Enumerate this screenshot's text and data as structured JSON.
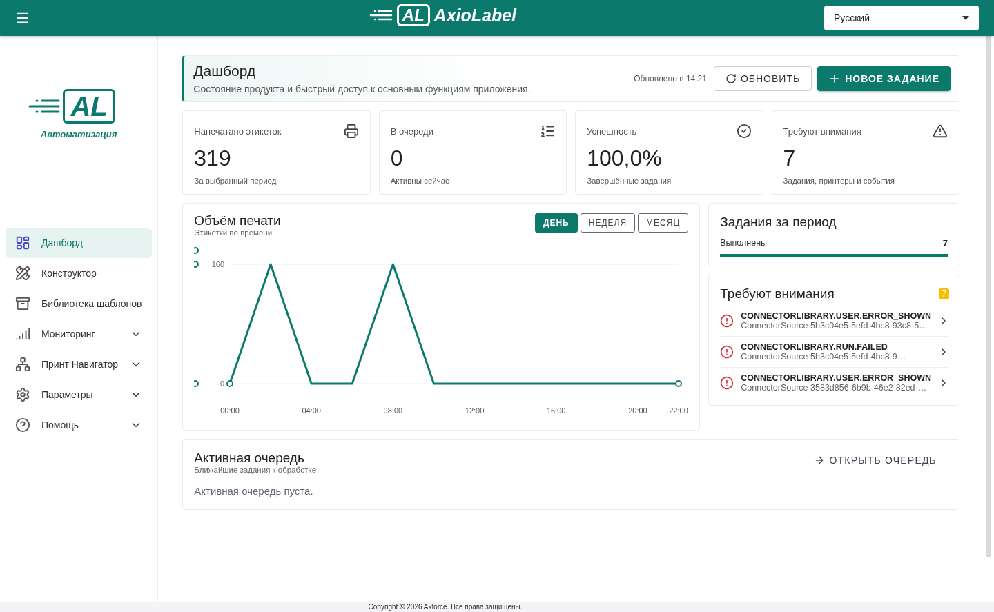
{
  "header": {
    "logo_mark": "AL",
    "brand": "AxioLabel",
    "language": "Русский"
  },
  "sidebar": {
    "logo_mark": "AL",
    "logo_caption": "Автоматизация",
    "items": [
      {
        "label": "Дашборд",
        "selected": true,
        "expandable": false
      },
      {
        "label": "Конструктор",
        "selected": false,
        "expandable": false
      },
      {
        "label": "Библиотека шаблонов",
        "selected": false,
        "expandable": false
      },
      {
        "label": "Мониторинг",
        "selected": false,
        "expandable": true
      },
      {
        "label": "Принт Навигатор",
        "selected": false,
        "expandable": true
      },
      {
        "label": "Параметры",
        "selected": false,
        "expandable": true
      },
      {
        "label": "Помощь",
        "selected": false,
        "expandable": true
      }
    ]
  },
  "page_header": {
    "title": "Дашборд",
    "subtitle": "Состояние продукта и быстрый доступ к основным функциям приложения.",
    "updated": "Обновлено в 14:21",
    "refresh_button": "ОБНОВИТЬ",
    "new_button": "НОВОЕ ЗАДАНИЕ"
  },
  "stats": [
    {
      "label": "Напечатано этикеток",
      "value": "319",
      "caption": "За выбранный период"
    },
    {
      "label": "В очереди",
      "value": "0",
      "caption": "Активны сейчас"
    },
    {
      "label": "Успешность",
      "value": "100,0%",
      "caption": "Завершённые задания"
    },
    {
      "label": "Требуют внимания",
      "value": "7",
      "caption": "Задания, принтеры и события"
    }
  ],
  "volume": {
    "title": "Объём печати",
    "subtitle": "Этикетки по времени",
    "periods": [
      {
        "label": "ДЕНЬ",
        "selected": true
      },
      {
        "label": "НЕДЕЛЯ",
        "selected": false
      },
      {
        "label": "МЕСЯЦ",
        "selected": false
      }
    ],
    "chart_data": {
      "type": "line",
      "x": [
        0,
        2,
        4,
        6,
        8,
        10,
        12,
        14,
        16,
        18,
        20,
        22
      ],
      "series": [
        {
          "color": "#0b7a6d",
          "values": [
            0,
            160,
            0,
            0,
            160,
            0,
            0,
            0,
            0,
            0,
            0,
            0
          ]
        }
      ],
      "ylim": [
        0,
        160
      ],
      "yticks": [
        0,
        160
      ],
      "ref_lines": [
        {
          "axis": "y",
          "value": 53.33
        },
        {
          "axis": "y",
          "value": 106.67
        }
      ],
      "xlim": [
        0,
        22
      ],
      "xticks": [
        {
          "value": 0,
          "label": "00:00"
        },
        {
          "value": 4,
          "label": "04:00"
        },
        {
          "value": 8,
          "label": "08:00"
        },
        {
          "value": 12,
          "label": "12:00"
        },
        {
          "value": 16,
          "label": "16:00"
        },
        {
          "value": 20,
          "label": "20:00"
        },
        {
          "value": 22,
          "label": "22:00"
        }
      ]
    }
  },
  "jobs": {
    "title": "Задания за период",
    "rows": [
      {
        "label": "Выполнены",
        "count": "7",
        "level": 1.0
      }
    ]
  },
  "attention": {
    "title": "Требуют внимания",
    "badge": "7",
    "items": [
      {
        "title": "CONNECTORLIBRARY.USER.ERROR_SHOWN",
        "source": "ConnectorSource 5b3c04e5-5efd-4bc8-93c8-5…"
      },
      {
        "title": "CONNECTORLIBRARY.RUN.FAILED",
        "source": "ConnectorSource 5b3c04e5-5efd-4bc8-9…"
      },
      {
        "title": "CONNECTORLIBRARY.USER.ERROR_SHOWN",
        "source": "ConnectorSource 3583d856-6b9b-46e2-82ed-…"
      }
    ]
  },
  "queue": {
    "title": "Активная очередь",
    "subtitle": "Ближайшие задания к обработке",
    "open_button": "ОТКРЫТЬ ОЧЕРЕДЬ",
    "empty": "Активная очередь пуста."
  },
  "footer": {
    "text": "Copyright © 2026 Akforce. Все права защищены."
  }
}
